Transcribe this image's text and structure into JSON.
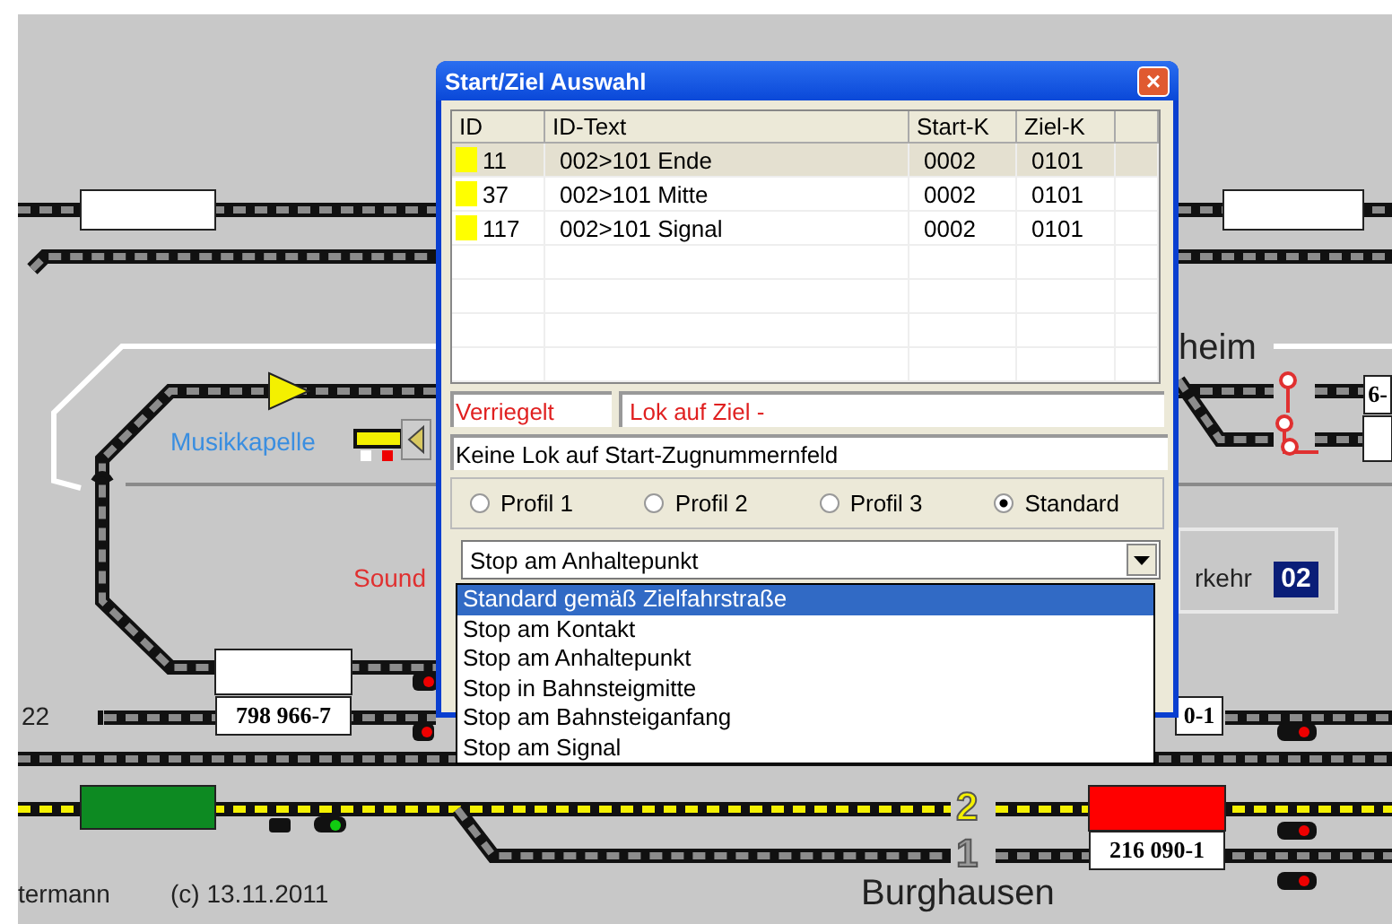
{
  "layout": {
    "labels": [
      {
        "kind": "big",
        "text": "heim"
      },
      {
        "kind": "blue",
        "text": "Musikkapelle"
      },
      {
        "kind": "red",
        "text": "Sound"
      },
      {
        "kind": "plain",
        "text": "rkehr"
      },
      {
        "kind": "plain",
        "text": "22"
      },
      {
        "kind": "yellow-num",
        "text": "2"
      },
      {
        "kind": "grey-num",
        "text": "1"
      },
      {
        "kind": "plain",
        "text": "termann"
      },
      {
        "kind": "plain",
        "text": "(c) 13.11.2011"
      },
      {
        "kind": "big",
        "text": "Burghausen"
      }
    ],
    "track_counter": "02",
    "train_numbers": [
      "798 966-7",
      "216 090-1",
      "0-1",
      "6-"
    ]
  },
  "dialog": {
    "title": "Start/Ziel Auswahl",
    "close_label": "×",
    "columns": [
      "ID",
      "ID-Text",
      "Start-K",
      "Ziel-K"
    ],
    "rows": [
      {
        "id": "11",
        "text": "002>101 Ende",
        "start": "0002",
        "ziel": "0101",
        "color": "#ffff00",
        "selected": true
      },
      {
        "id": "37",
        "text": "002>101 Mitte",
        "start": "0002",
        "ziel": "0101",
        "color": "#ffff00",
        "selected": false
      },
      {
        "id": "117",
        "text": "002>101 Signal",
        "start": "0002",
        "ziel": "0101",
        "color": "#ffff00",
        "selected": false
      }
    ],
    "lock_status": "Verriegelt",
    "target_status": "Lok auf Ziel -",
    "message": "Keine Lok auf Start-Zugnummernfeld",
    "profiles": [
      {
        "label": "Profil 1",
        "selected": false
      },
      {
        "label": "Profil 2",
        "selected": false
      },
      {
        "label": "Profil 3",
        "selected": false
      },
      {
        "label": "Standard",
        "selected": true
      }
    ],
    "stop_mode": {
      "value": "Stop am Anhaltepunkt",
      "expanded": true,
      "options": [
        {
          "label": "Standard gemäß Zielfahrstraße",
          "highlighted": true
        },
        {
          "label": "Stop am Kontakt",
          "highlighted": false
        },
        {
          "label": "Stop am Anhaltepunkt",
          "highlighted": false
        },
        {
          "label": "Stop in Bahnsteigmitte",
          "highlighted": false
        },
        {
          "label": "Stop am Bahnsteiganfang",
          "highlighted": false
        },
        {
          "label": "Stop am Signal",
          "highlighted": false
        }
      ]
    }
  }
}
